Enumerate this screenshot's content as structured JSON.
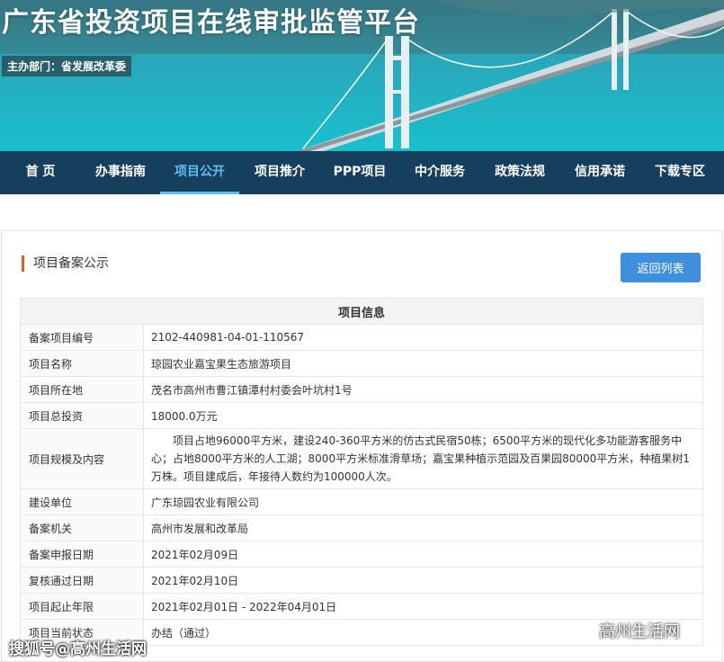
{
  "banner": {
    "title": "广东省投资项目在线审批监管平台",
    "sponsor": "主办部门：省发展改革委"
  },
  "nav": {
    "items": [
      {
        "label": "首 页",
        "active": false
      },
      {
        "label": "办事指南",
        "active": false
      },
      {
        "label": "项目公开",
        "active": true
      },
      {
        "label": "项目推介",
        "active": false
      },
      {
        "label": "PPP项目",
        "active": false
      },
      {
        "label": "中介服务",
        "active": false
      },
      {
        "label": "政策法规",
        "active": false
      },
      {
        "label": "信用承诺",
        "active": false
      },
      {
        "label": "下载专区",
        "active": false
      }
    ]
  },
  "section": {
    "title": "项目备案公示",
    "back_label": "返回列表"
  },
  "table": {
    "header": "项目信息",
    "rows": [
      {
        "label": "备案项目编号",
        "value": "2102-440981-04-01-110567"
      },
      {
        "label": "项目名称",
        "value": "琼园农业嘉宝果生态旅游项目"
      },
      {
        "label": "项目所在地",
        "value": "茂名市高州市曹江镇潭村村委会叶坑村1号"
      },
      {
        "label": "项目总投资",
        "value": "18000.0万元"
      },
      {
        "label": "项目规模及内容",
        "value": "项目占地96000平方米，建设240-360平方米的仿古式民宿50栋；6500平方米的现代化多功能游客服务中心；占地8000平方米的人工湖；8000平方米标准滑草场；嘉宝果种植示范园及百果园80000平方米，种植果树1万株。项目建成后，年接待人数约为100000人次。"
      },
      {
        "label": "建设单位",
        "value": "广东琼园农业有限公司"
      },
      {
        "label": "备案机关",
        "value": "高州市发展和改革局"
      },
      {
        "label": "备案申报日期",
        "value": "2021年02月09日"
      },
      {
        "label": "复核通过日期",
        "value": "2021年02月10日"
      },
      {
        "label": "项目起止年限",
        "value": "2021年02月01日 - 2022年04月01日"
      },
      {
        "label": "项目当前状态",
        "value": "办结（通过）"
      }
    ]
  },
  "watermark": {
    "left": "搜狐号@高州生活网",
    "right": "高州生活网",
    "right_icon": "wechat-icon"
  },
  "colors": {
    "nav_bg": "#163f5d",
    "nav_active": "#5fc0ee",
    "accent_bar": "#e35a2a",
    "button": "#3e8fdc"
  }
}
